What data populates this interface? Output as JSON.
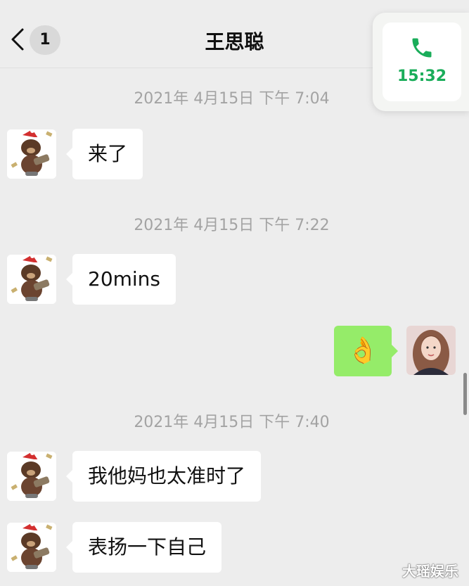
{
  "header": {
    "back_label": "<",
    "unread_count": "1",
    "title": "王思聪"
  },
  "call_widget": {
    "icon": "phone-icon",
    "duration": "15:32",
    "color": "#1aad5a"
  },
  "messages": [
    {
      "type": "timestamp",
      "text": "2021年 4月15日  下午 7:04"
    },
    {
      "type": "incoming",
      "text": "来了",
      "avatar": "bear-santa-hat-avatar"
    },
    {
      "type": "timestamp",
      "text": "2021年 4月15日  下午 7:22"
    },
    {
      "type": "incoming",
      "text": "20mins",
      "avatar": "bear-santa-hat-avatar"
    },
    {
      "type": "outgoing",
      "text": "👌",
      "avatar": "girl-photo-avatar"
    },
    {
      "type": "timestamp",
      "text": "2021年 4月15日  下午 7:40"
    },
    {
      "type": "incoming",
      "text": "我他妈也太准时了",
      "avatar": "bear-santa-hat-avatar"
    },
    {
      "type": "incoming",
      "text": "表扬一下自己",
      "avatar": "bear-santa-hat-avatar"
    }
  ],
  "watermark": "大瑶娱乐",
  "colors": {
    "background": "#ededed",
    "incoming_bubble": "#ffffff",
    "outgoing_bubble": "#95ec69",
    "timestamp_text": "#a3a3a3"
  }
}
